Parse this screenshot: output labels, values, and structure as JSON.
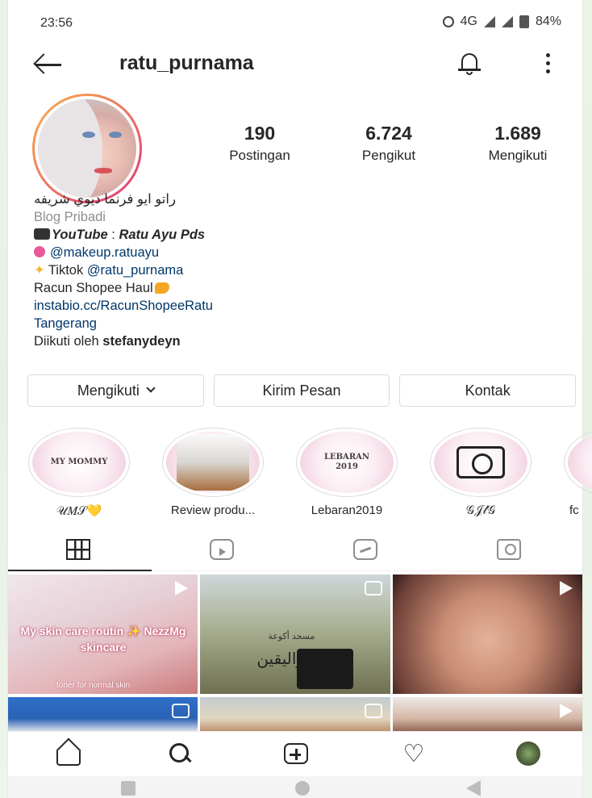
{
  "status_bar": {
    "time": "23:56",
    "network": "4G",
    "battery": "84%"
  },
  "header": {
    "username": "ratu_purnama",
    "icons": [
      "back-arrow-icon",
      "bell-icon",
      "more-vertical-icon"
    ]
  },
  "stats": [
    {
      "value": "190",
      "label": "Postingan"
    },
    {
      "value": "6.724",
      "label": "Pengikut"
    },
    {
      "value": "1.689",
      "label": "Mengikuti"
    }
  ],
  "bio": {
    "arabic_name": "راتو ايو فرنما ديوي شريفه",
    "category": "Blog Pribadi",
    "youtube_label": "YouTube",
    "youtube_sep": " : ",
    "youtube_value": "Ratu Ayu Pds",
    "makeup_handle": "@makeup.ratuayu",
    "tiktok_prefix": "Tiktok ",
    "tiktok_handle": "@ratu_purnama",
    "shopee": "Racun Shopee Haul",
    "link": "instabio.cc/RacunShopeeRatu",
    "location": "Tangerang",
    "followed_by_prefix": "Diikuti oleh ",
    "followed_by_user": "stefanydeyn"
  },
  "buttons": {
    "following": "Mengikuti",
    "message": "Kirim Pesan",
    "contact": "Kontak"
  },
  "highlights": [
    {
      "label": "𝒰𝑀𝒮💛",
      "cover_text": "MY MOMMY"
    },
    {
      "label": "Review produ...",
      "cover_text": ""
    },
    {
      "label": "Lebaran2019",
      "cover_text": "LEBARAN 2019"
    },
    {
      "label": "𝒢𝒥𝓁𝒢",
      "cover_text": ""
    },
    {
      "label": "fc",
      "cover_text": ""
    }
  ],
  "grid": {
    "post1_overlay": "My skin care routin ✨ NezzMg skincare",
    "post1_small": "toner for normal skin",
    "post2_shirt_top": "مسجد أكوعة",
    "post2_shirt_main": "نوراليقين"
  },
  "colors": {
    "accent_link": "#00376b",
    "text": "#262626",
    "muted": "#8e8e8e",
    "border": "#dbdbdb"
  }
}
